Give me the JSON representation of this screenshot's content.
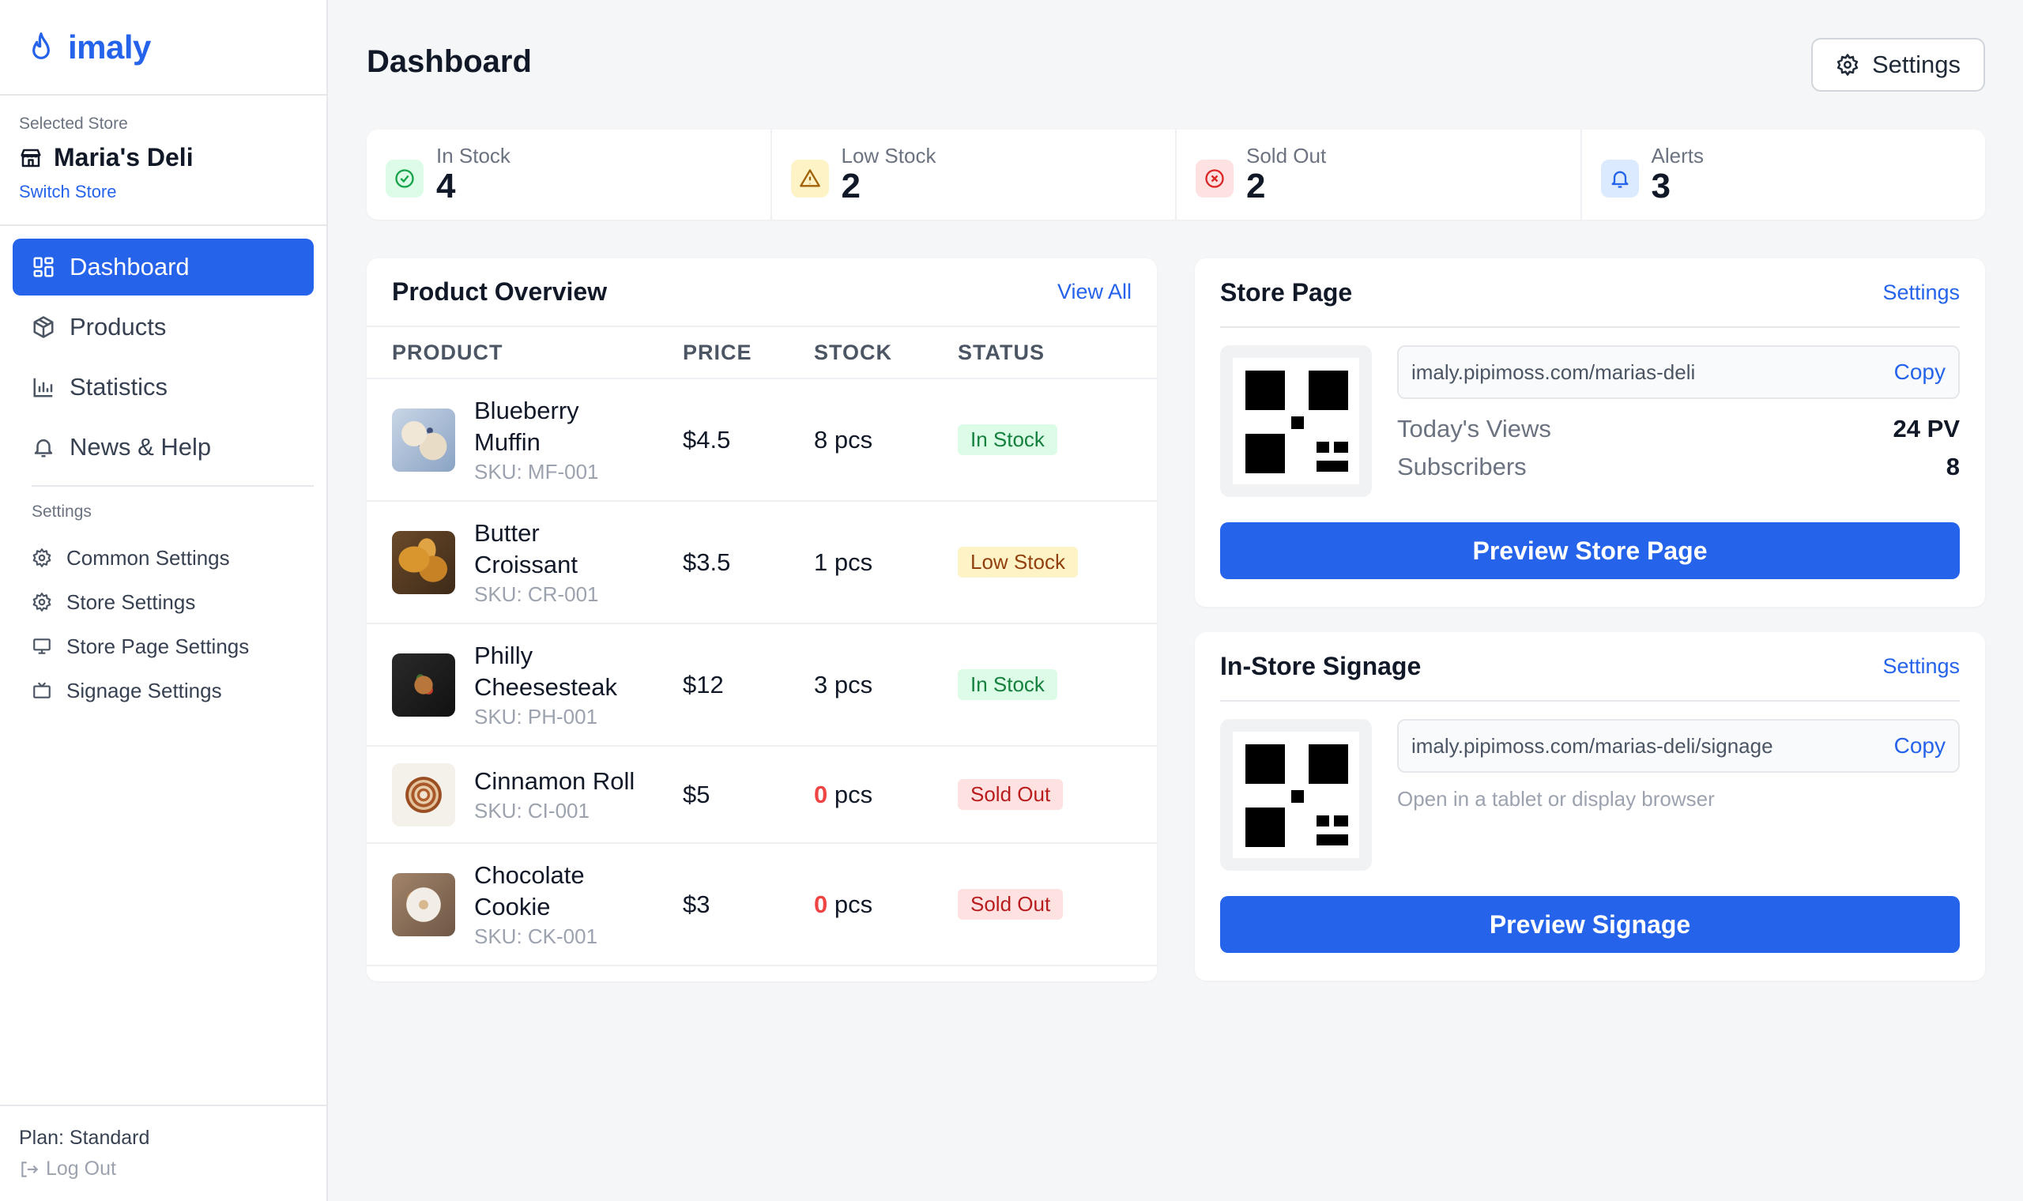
{
  "brand": {
    "name": "imaly"
  },
  "store": {
    "caption": "Selected Store",
    "name": "Maria's Deli",
    "switch_label": "Switch Store"
  },
  "nav": {
    "items": [
      {
        "label": "Dashboard",
        "icon": "dashboard-icon"
      },
      {
        "label": "Products",
        "icon": "box-icon"
      },
      {
        "label": "Statistics",
        "icon": "chart-icon"
      },
      {
        "label": "News & Help",
        "icon": "bell-icon"
      }
    ],
    "settings_caption": "Settings",
    "settings_items": [
      {
        "label": "Common Settings",
        "icon": "gear-icon"
      },
      {
        "label": "Store Settings",
        "icon": "gear-icon"
      },
      {
        "label": "Store Page Settings",
        "icon": "monitor-icon"
      },
      {
        "label": "Signage Settings",
        "icon": "tv-icon"
      }
    ]
  },
  "footer": {
    "plan": "Plan: Standard",
    "logout": "Log Out"
  },
  "header": {
    "title": "Dashboard",
    "settings_label": "Settings"
  },
  "stats": [
    {
      "label": "In Stock",
      "value": "4",
      "icon": "check-circle-icon",
      "color": "#16a34a",
      "bg": "#dcfce7"
    },
    {
      "label": "Low Stock",
      "value": "2",
      "icon": "warning-icon",
      "color": "#a16207",
      "bg": "#fef3c7"
    },
    {
      "label": "Sold Out",
      "value": "2",
      "icon": "x-circle-icon",
      "color": "#dc2626",
      "bg": "#fee2e2"
    },
    {
      "label": "Alerts",
      "value": "3",
      "icon": "bell-icon",
      "color": "#2563eb",
      "bg": "#dbeafe"
    }
  ],
  "overview": {
    "title": "Product Overview",
    "view_all": "View All",
    "columns": [
      "PRODUCT",
      "PRICE",
      "STOCK",
      "STATUS"
    ],
    "rows": [
      {
        "name1": "Blueberry",
        "name2": "Muffin",
        "sku": "SKU: MF-001",
        "price": "$4.5",
        "stock": "8",
        "unit": "pcs",
        "status": "In Stock",
        "status_kind": "green"
      },
      {
        "name1": "Butter",
        "name2": "Croissant",
        "sku": "SKU: CR-001",
        "price": "$3.5",
        "stock": "1",
        "unit": "pcs",
        "status": "Low Stock",
        "status_kind": "yellow"
      },
      {
        "name1": "Philly",
        "name2": "Cheesesteak",
        "sku": "SKU: PH-001",
        "price": "$12",
        "stock": "3",
        "unit": "pcs",
        "status": "In Stock",
        "status_kind": "green"
      },
      {
        "name1": "Cinnamon Roll",
        "name2": "",
        "sku": "SKU: CI-001",
        "price": "$5",
        "stock": "0",
        "unit": "pcs",
        "status": "Sold Out",
        "status_kind": "red"
      },
      {
        "name1": "Chocolate",
        "name2": "Cookie",
        "sku": "SKU: CK-001",
        "price": "$3",
        "stock": "0",
        "unit": "pcs",
        "status": "Sold Out",
        "status_kind": "red"
      }
    ]
  },
  "store_page": {
    "title": "Store Page",
    "settings_link": "Settings",
    "url": "imaly.pipimoss.com/marias-deli",
    "copy_label": "Copy",
    "views_label": "Today's Views",
    "views_value": "24 PV",
    "subs_label": "Subscribers",
    "subs_value": "8",
    "button": "Preview Store Page"
  },
  "signage": {
    "title": "In-Store Signage",
    "settings_link": "Settings",
    "url": "imaly.pipimoss.com/marias-deli/signage",
    "copy_label": "Copy",
    "hint": "Open in a tablet or display browser",
    "button": "Preview Signage"
  }
}
